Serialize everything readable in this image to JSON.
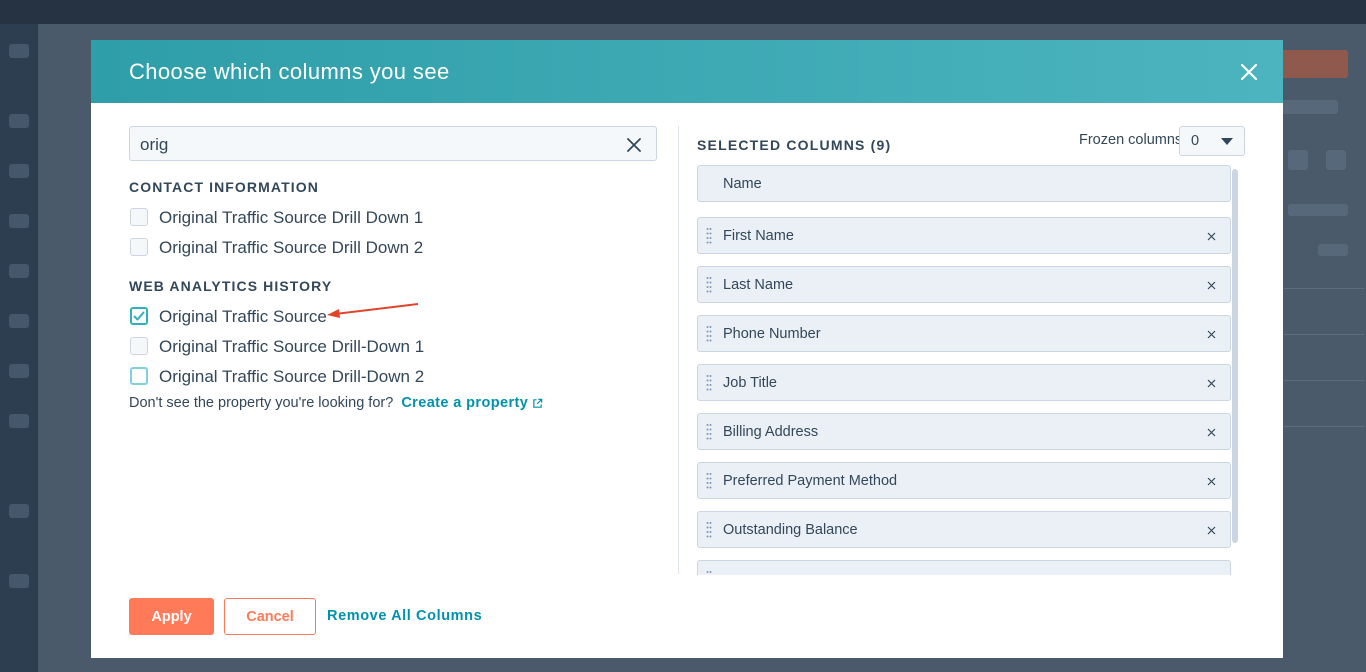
{
  "modal": {
    "title": "Choose which columns you see"
  },
  "search": {
    "value": "orig"
  },
  "groups": [
    {
      "heading": "CONTACT INFORMATION",
      "options": [
        {
          "label": "Original Traffic Source Drill Down 1",
          "checked": false
        },
        {
          "label": "Original Traffic Source Drill Down 2",
          "checked": false
        }
      ]
    },
    {
      "heading": "WEB ANALYTICS HISTORY",
      "options": [
        {
          "label": "Original Traffic Source",
          "checked": true
        },
        {
          "label": "Original Traffic Source Drill-Down 1",
          "checked": false
        },
        {
          "label": "Original Traffic Source Drill-Down 2",
          "checked": false
        }
      ]
    }
  ],
  "helper": {
    "text": "Don't see the property you're looking for?",
    "link": "Create a property"
  },
  "selected": {
    "heading": "SELECTED COLUMNS (9)",
    "frozen_label": "Frozen columns",
    "frozen_value": "0",
    "columns": [
      "Name",
      "First Name",
      "Last Name",
      "Phone Number",
      "Job Title",
      "Billing Address",
      "Preferred Payment Method",
      "Outstanding Balance"
    ]
  },
  "footer": {
    "apply": "Apply",
    "cancel": "Cancel",
    "remove_all": "Remove All Columns"
  },
  "colors": {
    "header_teal": "#4cb4bf",
    "accent_orange": "#ff7a59",
    "link_blue": "#0091ae",
    "checkbox_teal": "#2eb1bd",
    "annotation_red": "#e0452b"
  }
}
